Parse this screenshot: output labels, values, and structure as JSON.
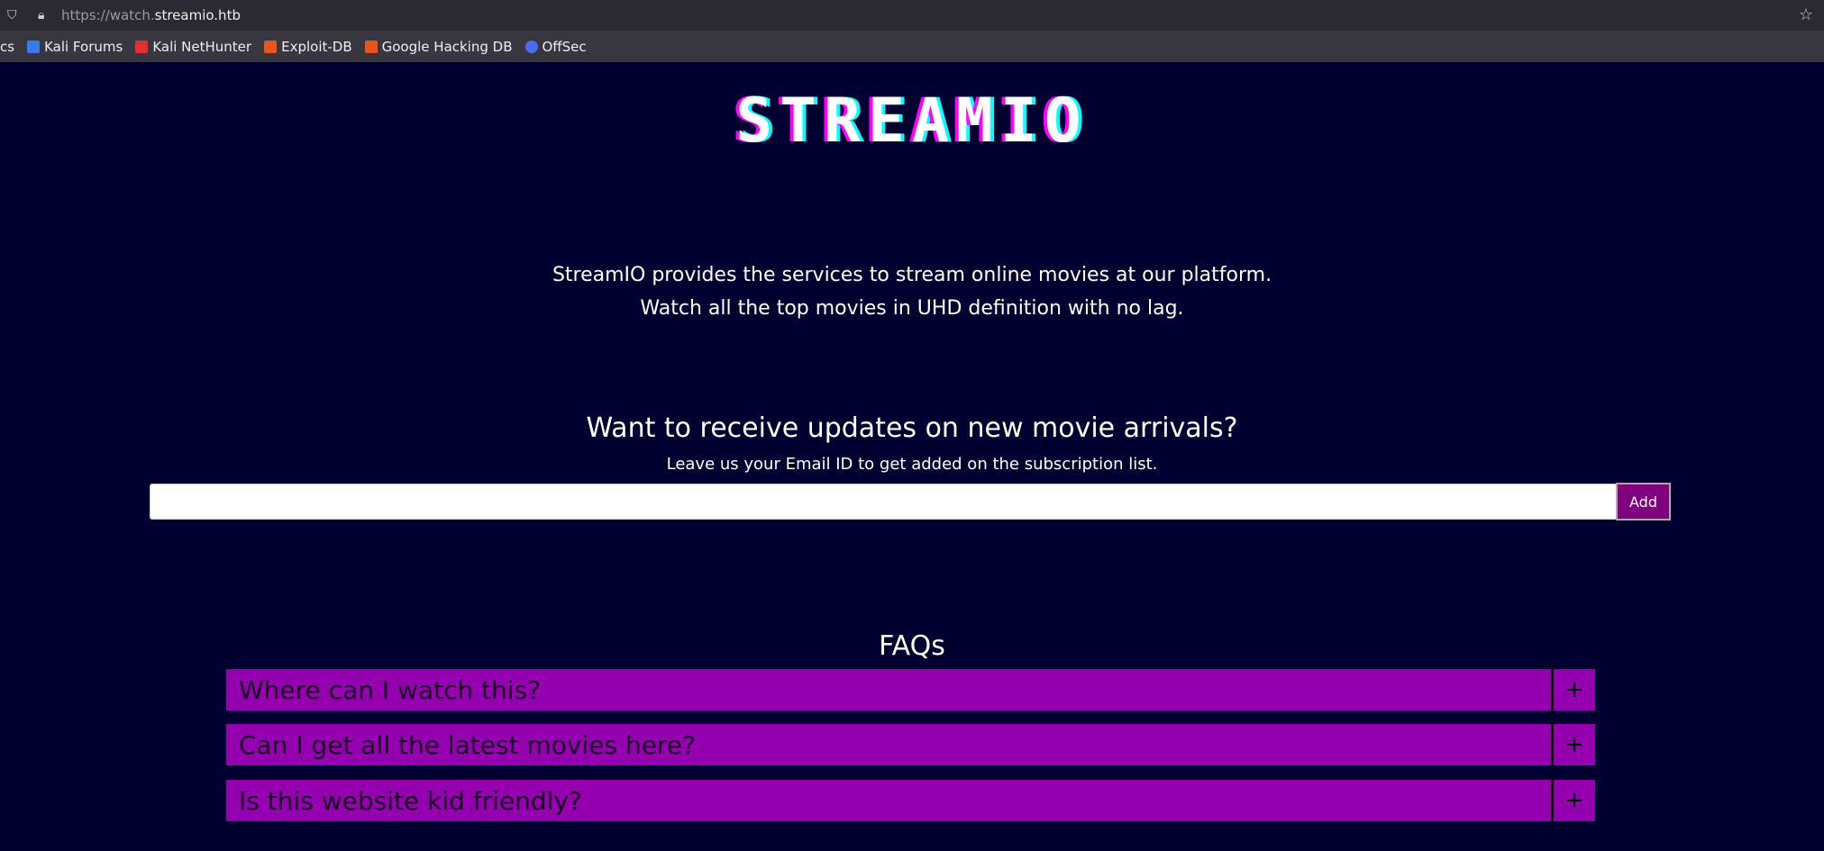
{
  "browser": {
    "url_prefix": "https://watch.",
    "url_host": "streamio.htb",
    "bookmarks": [
      {
        "label": "cs",
        "color": "#38373f"
      },
      {
        "label": "Kali Forums",
        "color": "#367bf0"
      },
      {
        "label": "Kali NetHunter",
        "color": "#e03030"
      },
      {
        "label": "Exploit-DB",
        "color": "#e8561e"
      },
      {
        "label": "Google Hacking DB",
        "color": "#e8561e"
      },
      {
        "label": "OffSec",
        "color": "#4a6cf0"
      }
    ]
  },
  "page": {
    "logo": "STREAMIO",
    "intro_line1": "StreamIO provides the services to stream online movies at our platform.",
    "intro_line2": "Watch all the top movies in UHD definition with no lag.",
    "subscribe_heading": "Want to receive updates on new movie arrivals?",
    "subscribe_sub": "Leave us your Email ID to get added on the subscription list.",
    "email_value": "",
    "add_label": "Add",
    "faq_heading": "FAQs",
    "faqs": [
      {
        "q": "Where can I watch this?",
        "toggle": "+"
      },
      {
        "q": "Can I get all the latest movies here?",
        "toggle": "+"
      },
      {
        "q": "Is this website kid friendly?",
        "toggle": "+"
      }
    ]
  },
  "colors": {
    "background": "#000030",
    "faq": "#9400b0",
    "button": "#800080"
  }
}
